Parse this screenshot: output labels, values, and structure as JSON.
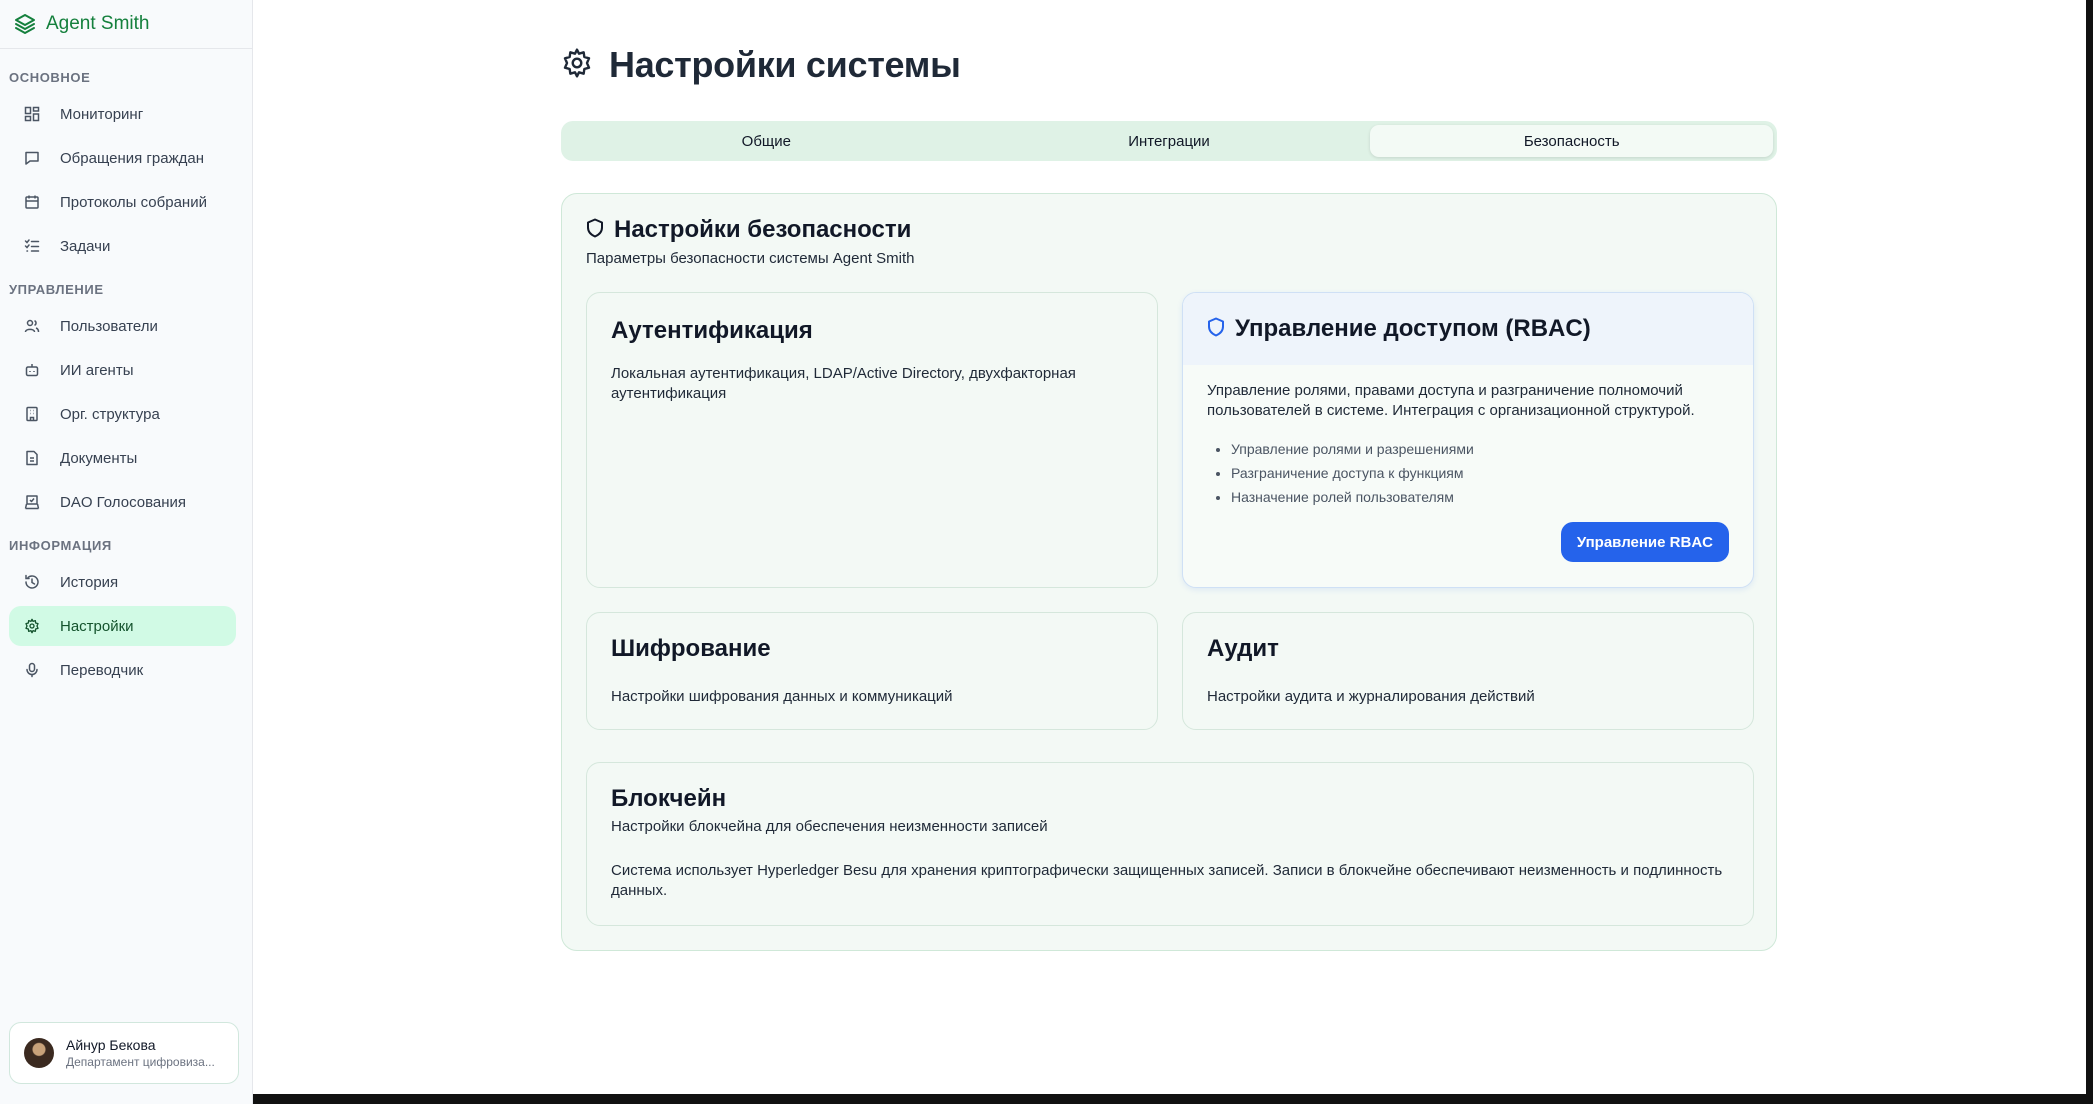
{
  "brand": {
    "name": "Agent Smith",
    "color": "#15803d"
  },
  "sidebar": {
    "sections": [
      {
        "title": "ОСНОВНОЕ"
      },
      {
        "title": "УПРАВЛЕНИЕ"
      },
      {
        "title": "ИНФОРМАЦИЯ"
      }
    ],
    "items": [
      {
        "label": "Мониторинг",
        "icon": "dashboard-icon"
      },
      {
        "label": "Обращения граждан",
        "icon": "message-icon"
      },
      {
        "label": "Протоколы собраний",
        "icon": "calendar-icon"
      },
      {
        "label": "Задачи",
        "icon": "tasks-icon"
      },
      {
        "label": "Пользователи",
        "icon": "users-icon"
      },
      {
        "label": "ИИ агенты",
        "icon": "bot-icon"
      },
      {
        "label": "Орг. структура",
        "icon": "building-icon"
      },
      {
        "label": "Документы",
        "icon": "document-icon"
      },
      {
        "label": "DAO Голосования",
        "icon": "vote-icon"
      },
      {
        "label": "История",
        "icon": "history-icon"
      },
      {
        "label": "Настройки",
        "icon": "gear-icon",
        "active": true
      },
      {
        "label": "Переводчик",
        "icon": "mic-icon"
      }
    ],
    "user": {
      "name": "Айнур Бекова",
      "department": "Департамент цифровиза..."
    }
  },
  "page": {
    "title": "Настройки системы"
  },
  "tabs": [
    {
      "label": "Общие"
    },
    {
      "label": "Интеграции"
    },
    {
      "label": "Безопасность",
      "active": true
    }
  ],
  "security": {
    "title": "Настройки безопасности",
    "subtitle": "Параметры безопасности системы Agent Smith",
    "auth": {
      "title": "Аутентификация",
      "description": "Локальная аутентификация, LDAP/Active Directory, двухфакторная аутентификация"
    },
    "rbac": {
      "title": "Управление доступом (RBAC)",
      "description": "Управление ролями, правами доступа и разграничение полномочий пользователей в системе. Интеграция с организационной структурой.",
      "features": [
        "Управление ролями и разрешениями",
        "Разграничение доступа к функциям",
        "Назначение ролей пользователям"
      ],
      "button": "Управление RBAC",
      "accent": "#2563eb"
    },
    "encryption": {
      "title": "Шифрование",
      "description": "Настройки шифрования данных и коммуникаций"
    },
    "audit": {
      "title": "Аудит",
      "description": "Настройки аудита и журналирования действий"
    },
    "blockchain": {
      "title": "Блокчейн",
      "subtitle": "Настройки блокчейна для обеспечения неизменности записей",
      "description": "Система использует Hyperledger Besu для хранения криптографически защищенных записей. Записи в блокчейне обеспечивают неизменность и подлинность данных."
    }
  }
}
